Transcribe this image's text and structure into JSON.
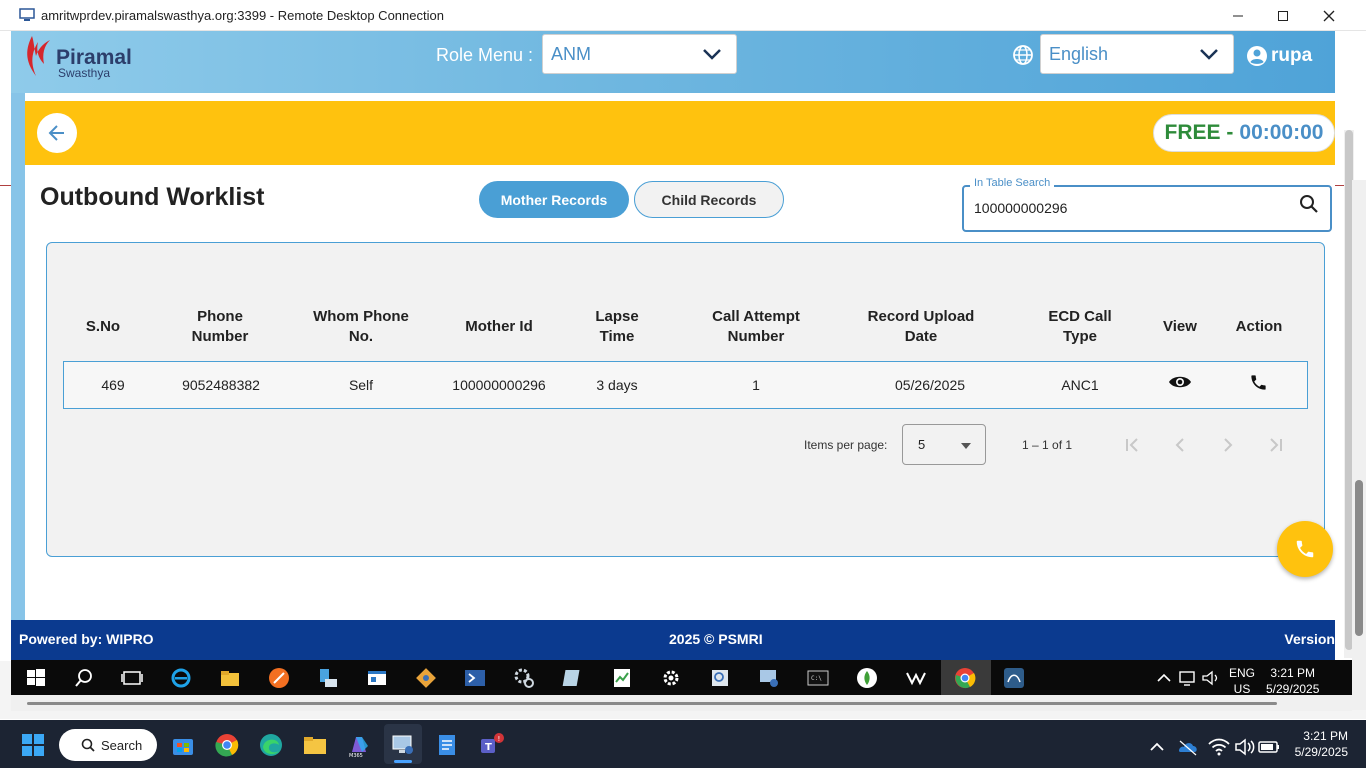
{
  "window": {
    "title": "amritwprdev.piramalswasthya.org:3399 - Remote Desktop Connection"
  },
  "header": {
    "logo_name": "Piramal",
    "logo_sub": "Swasthya",
    "role_label": "Role Menu :",
    "role_value": "ANM",
    "language_value": "English",
    "user_name": "rupa"
  },
  "status": {
    "free_label": "FREE -",
    "timer": "00:00:00"
  },
  "page": {
    "title": "Outbound Worklist",
    "tab_mother": "Mother Records",
    "tab_child": "Child Records",
    "search_label": "In Table Search",
    "search_value": "100000000296"
  },
  "table": {
    "headers": [
      "S.No",
      "Phone Number",
      "Whom Phone No.",
      "Mother Id",
      "Lapse Time",
      "Call Attempt Number",
      "Record Upload Date",
      "ECD Call Type",
      "View",
      "Action"
    ],
    "rows": [
      [
        "469",
        "9052488382",
        "Self",
        "100000000296",
        "3 days",
        "1",
        "05/26/2025",
        "ANC1"
      ]
    ]
  },
  "paginator": {
    "items_label": "Items per page:",
    "page_size": "5",
    "range": "1 – 1 of 1"
  },
  "footer": {
    "powered": "Powered by: WIPRO",
    "copyright": "2025 © PSMRI",
    "version": "Version"
  },
  "remote_taskbar": {
    "lang_line1": "ENG",
    "lang_line2": "US",
    "time": "3:21 PM",
    "date": "5/29/2025"
  },
  "taskbar": {
    "search_label": "Search",
    "time": "3:21 PM",
    "date": "5/29/2025"
  },
  "colors": {
    "header_blue": "#4fa3d8",
    "accent_yellow": "#ffc20e",
    "footer_navy": "#0b3a8f",
    "free_green": "#2e8b3a"
  }
}
